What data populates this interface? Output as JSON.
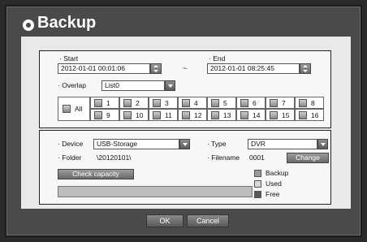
{
  "window": {
    "title": "Backup"
  },
  "range": {
    "start_label": "· Start",
    "start_value": "2012-01-01 00:01:06",
    "dash": "~",
    "end_label": "· End",
    "end_value": "2012-01-01 08:25:45"
  },
  "overlap": {
    "label": "· Overlap",
    "value": "List0"
  },
  "channels": {
    "all_label": "All",
    "row1": [
      "1",
      "2",
      "3",
      "4",
      "5",
      "6",
      "7",
      "8"
    ],
    "row2": [
      "9",
      "10",
      "11",
      "12",
      "13",
      "14",
      "15",
      "16"
    ]
  },
  "device": {
    "label": "· Device",
    "value": "USB-Storage"
  },
  "type": {
    "label": "· Type",
    "value": "DVR"
  },
  "folder": {
    "label": "· Folder",
    "value": "\\20120101\\"
  },
  "filename": {
    "label": "· Filename",
    "value": "0001",
    "change_label": "Change"
  },
  "check_capacity_label": "Check capacity",
  "capacity_legend": {
    "backup": "Backup",
    "used": "Used",
    "free": "Free"
  },
  "colors": {
    "backup": "#9a9a9a",
    "used": "#d8d8d8",
    "free": "#5a5a5a"
  },
  "footer": {
    "ok_label": "OK",
    "cancel_label": "Cancel"
  }
}
